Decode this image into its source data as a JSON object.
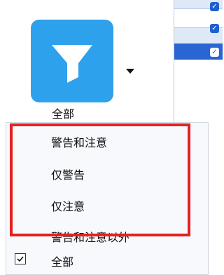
{
  "filter": {
    "icon": "funnel-icon",
    "caption": "全部"
  },
  "menu": {
    "items": [
      {
        "label": "警告和注意",
        "checked": false
      },
      {
        "label": "仅警告",
        "checked": false
      },
      {
        "label": "仅注意",
        "checked": false
      },
      {
        "label": "警告和注意以外",
        "checked": false
      },
      {
        "label": "全部",
        "checked": true
      }
    ]
  },
  "colors": {
    "filter_button": "#2ea1ec",
    "highlight_border": "#e52020",
    "grid_selected_row": "#2a66d3"
  }
}
